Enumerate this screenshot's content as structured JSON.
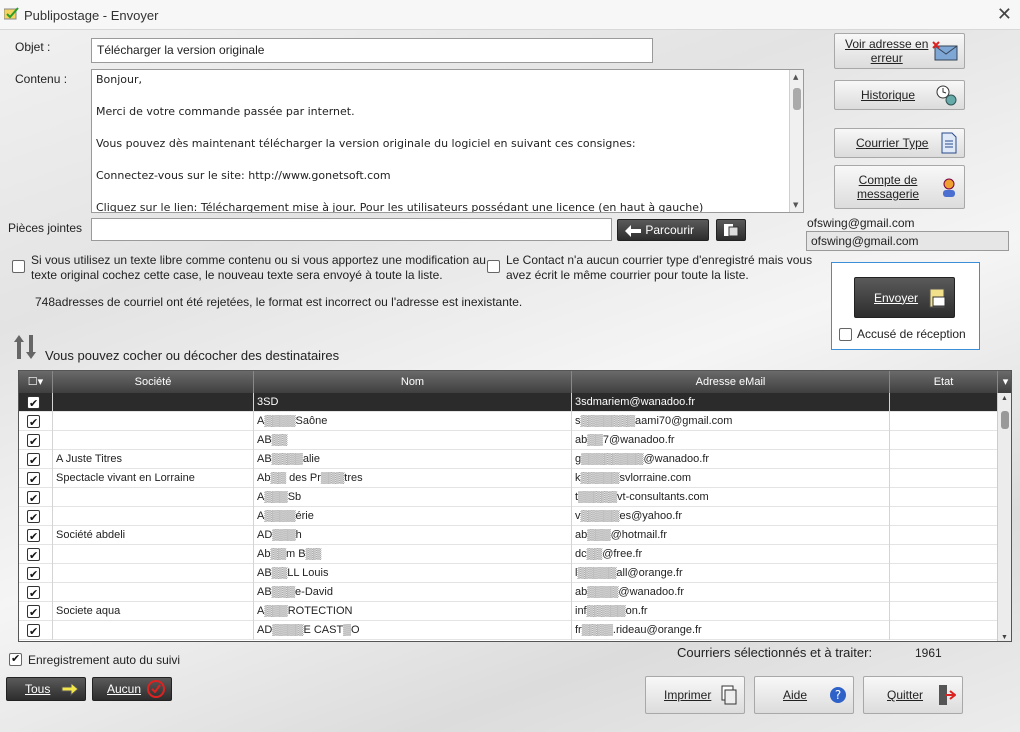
{
  "window": {
    "title": "Publipostage - Envoyer"
  },
  "form": {
    "objet_label": "Objet :",
    "objet_value": "Télécharger la version originale",
    "contenu_label": "Contenu :",
    "contenu_lines": [
      "Bonjour,",
      "",
      "Merci de votre commande passée par internet.",
      "",
      "Vous pouvez dès maintenant télécharger la version originale du logiciel en suivant ces consignes:",
      "",
      "Connectez-vous sur le site:  http://www.gonetsoft.com",
      "",
      "Cliquez sur le lien: Téléchargement mise à jour. Pour les utilisateurs possédant une licence (en haut à gauche)"
    ],
    "pj_label": "Pièces jointes",
    "pj_value": "",
    "parcourir_label": "Parcourir",
    "option1_text_l1": "Si vous utilisez un texte libre comme contenu ou si vous apportez une modification au",
    "option1_text_l2": "texte original cochez cette case, le nouveau texte sera envoyé à toute la liste.",
    "option2_text_l1": "Le Contact n'a aucun courrier type d'enregistré mais vous",
    "option2_text_l2": "avez écrit le même courrier pour toute la liste.",
    "rejected_text": "748adresses de courriel ont été rejetées, le format est incorrect ou l'adresse est inexistante.",
    "recipients_title": "Vous pouvez cocher ou décocher des destinataires"
  },
  "side": {
    "voir_adresse_l1": "Voir adresse en",
    "voir_adresse_l2": "erreur",
    "historique": "Historique",
    "courrier_type": "Courrier Type",
    "compte_l1": "Compte de",
    "compte_l2": "messagerie",
    "email_label": "ofswing@gmail.com",
    "email_value": "ofswing@gmail.com",
    "envoyer": "Envoyer",
    "accuse": "Accusé de réception"
  },
  "grid": {
    "headers": {
      "societe": "Société",
      "nom": "Nom",
      "email": "Adresse eMail",
      "etat": "Etat"
    },
    "rows": [
      {
        "societe": "",
        "nom": "3SD",
        "email": "3sdmariem@wanadoo.fr",
        "etat": ""
      },
      {
        "societe": "",
        "nom": "A▒▒▒▒Saône",
        "email": "s▒▒▒▒▒▒▒aami70@gmail.com",
        "etat": ""
      },
      {
        "societe": "",
        "nom": "AB▒▒",
        "email": "ab▒▒7@wanadoo.fr",
        "etat": ""
      },
      {
        "societe": "A Juste Titres",
        "nom": "AB▒▒▒▒alie",
        "email": "g▒▒▒▒▒▒▒▒@wanadoo.fr",
        "etat": ""
      },
      {
        "societe": "Spectacle vivant en Lorraine",
        "nom": "Ab▒▒ des Pr▒▒▒tres",
        "email": "k▒▒▒▒▒svlorraine.com",
        "etat": ""
      },
      {
        "societe": "",
        "nom": "A▒▒▒Sb",
        "email": "t▒▒▒▒▒vt-consultants.com",
        "etat": ""
      },
      {
        "societe": "",
        "nom": "A▒▒▒▒érie",
        "email": "v▒▒▒▒▒es@yahoo.fr",
        "etat": ""
      },
      {
        "societe": "Société abdeli",
        "nom": "AD▒▒▒h",
        "email": "ab▒▒▒@hotmail.fr",
        "etat": ""
      },
      {
        "societe": "",
        "nom": "Ab▒▒m B▒▒",
        "email": "dc▒▒@free.fr",
        "etat": ""
      },
      {
        "societe": "",
        "nom": "AB▒▒LL Louis",
        "email": "l▒▒▒▒▒all@orange.fr",
        "etat": ""
      },
      {
        "societe": "",
        "nom": "AB▒▒▒e-David",
        "email": "ab▒▒▒▒@wanadoo.fr",
        "etat": ""
      },
      {
        "societe": "Societe aqua",
        "nom": "A▒▒▒ROTECTION",
        "email": "inf▒▒▒▒▒on.fr",
        "etat": ""
      },
      {
        "societe": "",
        "nom": "AD▒▒▒▒E CAST▒O",
        "email": "fr▒▒▒▒.rideau@orange.fr",
        "etat": ""
      }
    ]
  },
  "bottom": {
    "auto_suivi": "Enregistrement auto du suivi",
    "tous": "Tous",
    "aucun": "Aucun",
    "courriers_label": "Courriers  sélectionnés et à traiter:",
    "courriers_count": "1961",
    "imprimer": "Imprimer",
    "aide": "Aide",
    "quitter": "Quitter"
  },
  "icons": {
    "app": "mail-merge-icon",
    "close": "close-icon",
    "envelope_error": "envelope-error-icon",
    "history": "history-icon",
    "document": "document-icon",
    "account": "account-icon",
    "send": "send-icon",
    "print": "print-icon",
    "help": "help-icon",
    "exit": "exit-icon",
    "back": "back-arrow-icon",
    "select_all": "pointer-hand-icon",
    "none": "no-check-icon"
  }
}
